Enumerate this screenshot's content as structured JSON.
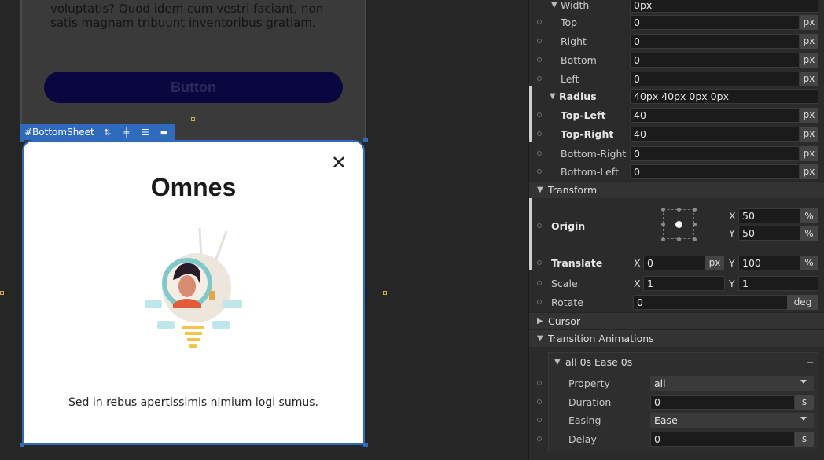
{
  "canvas": {
    "page_text": "voluptatis? Quod idem cum vestri faciant, non satis magnam tribuunt inventoribus gratiam.",
    "ghost_button_label": "Button",
    "selection_label": "#BottomSheet",
    "sheet": {
      "title": "Omnes",
      "close_glyph": "✕",
      "caption": "Sed in rebus apertissimis nimium logi sumus."
    }
  },
  "panel": {
    "width_row": {
      "label": "Width",
      "value": "0px"
    },
    "border": [
      {
        "label": "Top",
        "value": "0",
        "unit": "px"
      },
      {
        "label": "Right",
        "value": "0",
        "unit": "px"
      },
      {
        "label": "Bottom",
        "value": "0",
        "unit": "px"
      },
      {
        "label": "Left",
        "value": "0",
        "unit": "px"
      }
    ],
    "radius": {
      "label": "Radius",
      "value": "40px 40px 0px 0px"
    },
    "radius_items": [
      {
        "label": "Top-Left",
        "value": "40",
        "unit": "px"
      },
      {
        "label": "Top-Right",
        "value": "40",
        "unit": "px"
      },
      {
        "label": "Bottom-Right",
        "value": "0",
        "unit": "px"
      },
      {
        "label": "Bottom-Left",
        "value": "0",
        "unit": "px"
      }
    ],
    "transform": {
      "title": "Transform",
      "origin_label": "Origin",
      "origin_x": "50",
      "origin_y": "50",
      "origin_unit": "%",
      "translate_label": "Translate",
      "translate_x": "0",
      "translate_x_unit": "px",
      "translate_y": "100",
      "translate_y_unit": "%",
      "scale_label": "Scale",
      "scale_x": "1",
      "scale_y": "1",
      "rotate_label": "Rotate",
      "rotate_value": "0",
      "rotate_unit": "deg",
      "x_label": "X",
      "y_label": "Y"
    },
    "cursor": {
      "title": "Cursor"
    },
    "transitions": {
      "title": "Transition Animations",
      "item_title": "all 0s Ease 0s",
      "remove_glyph": "−",
      "property_label": "Property",
      "property_value": "all",
      "duration_label": "Duration",
      "duration_value": "0",
      "duration_unit": "s",
      "easing_label": "Easing",
      "easing_value": "Ease",
      "delay_label": "Delay",
      "delay_value": "0",
      "delay_unit": "s"
    }
  }
}
